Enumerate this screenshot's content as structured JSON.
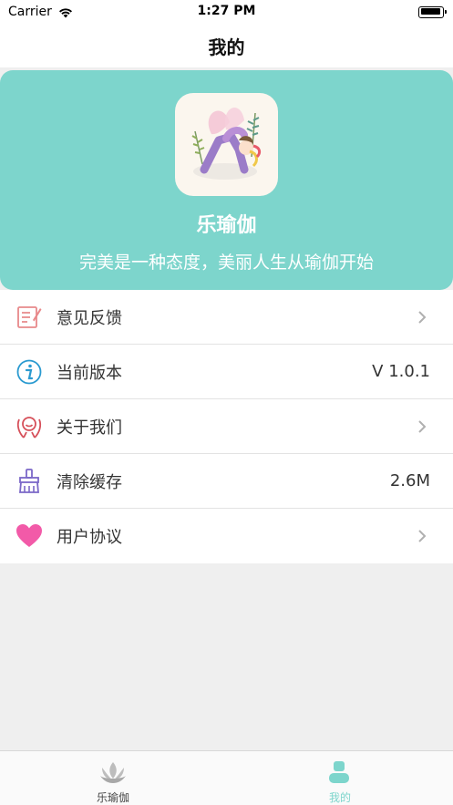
{
  "status_bar": {
    "carrier": "Carrier",
    "time": "1:27 PM"
  },
  "nav": {
    "title": "我的"
  },
  "header": {
    "app_name": "乐瑜伽",
    "slogan": "完美是一种态度，美丽人生从瑜伽开始",
    "background_color": "#7dd5cc"
  },
  "menu": {
    "items": [
      {
        "label": "意见反馈",
        "value": "",
        "icon": "feedback-edit-icon"
      },
      {
        "label": "当前版本",
        "value": "V 1.0.1",
        "icon": "info-icon"
      },
      {
        "label": "关于我们",
        "value": "",
        "icon": "about-us-icon"
      },
      {
        "label": "清除缓存",
        "value": "2.6M",
        "icon": "broom-icon"
      },
      {
        "label": "用户协议",
        "value": "",
        "icon": "heart-icon"
      }
    ]
  },
  "tab_bar": {
    "tabs": [
      {
        "label": "乐瑜伽",
        "icon": "lotus-icon",
        "active": false
      },
      {
        "label": "我的",
        "icon": "person-icon",
        "active": true
      }
    ],
    "active_color": "#7dd5cc",
    "inactive_color": "#444444"
  }
}
